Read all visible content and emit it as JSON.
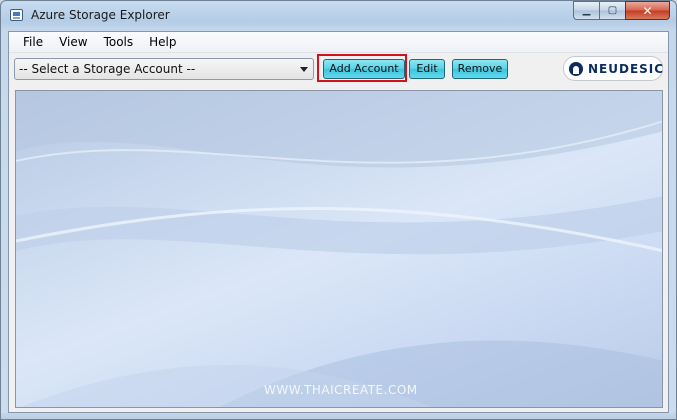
{
  "window": {
    "title": "Azure Storage Explorer",
    "controls": {
      "minimize": "▁",
      "maximize": "▢",
      "close": "✕"
    }
  },
  "menu": {
    "items": [
      "File",
      "View",
      "Tools",
      "Help"
    ]
  },
  "toolbar": {
    "account_select": {
      "value": "-- Select a Storage Account --"
    },
    "add_account_label": "Add Account",
    "edit_label": "Edit",
    "remove_label": "Remove",
    "logo_text": "NEUDESIC"
  },
  "content": {
    "watermark": "WWW.THAICREATE.COM"
  },
  "colors": {
    "button_accent": "#55d2e6",
    "highlight_border": "#d4121a",
    "logo_color": "#0b2d5e"
  }
}
